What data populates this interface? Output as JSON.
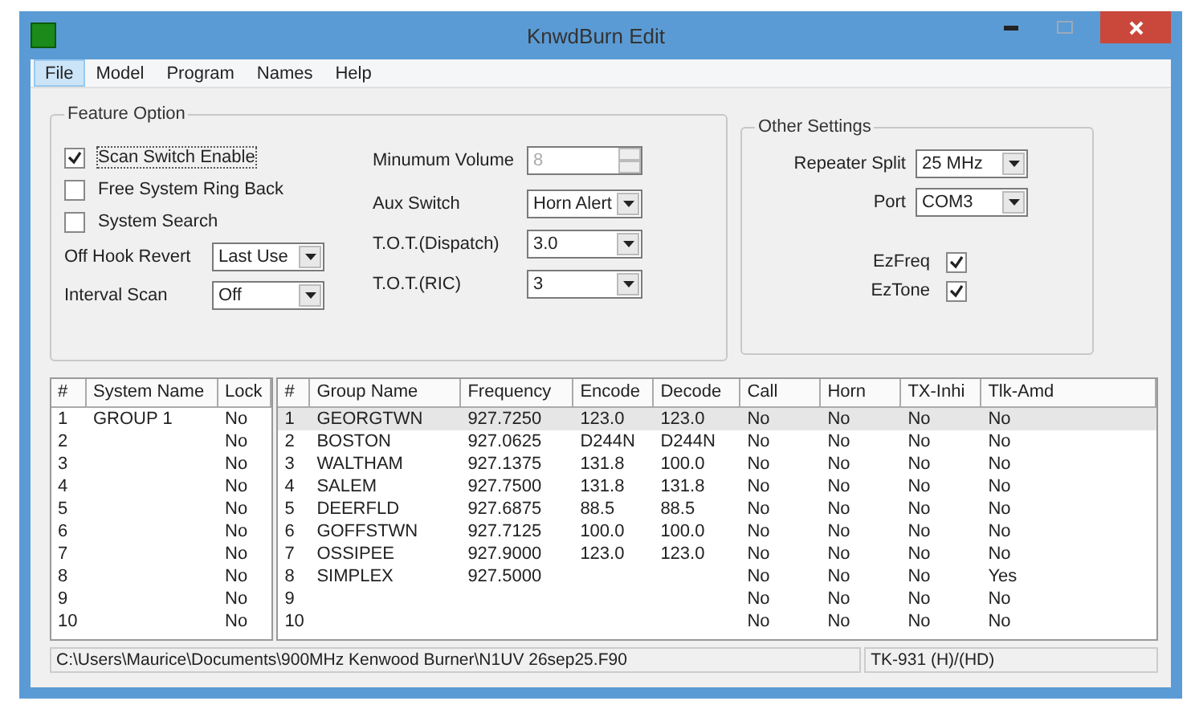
{
  "window": {
    "title": "KnwdBurn Edit"
  },
  "menu": [
    {
      "label": "File",
      "selected": true
    },
    {
      "label": "Model",
      "selected": false
    },
    {
      "label": "Program",
      "selected": false
    },
    {
      "label": "Names",
      "selected": false
    },
    {
      "label": "Help",
      "selected": false
    }
  ],
  "feature_option": {
    "title": "Feature Option",
    "checkboxes": [
      {
        "label": "Scan Switch Enable",
        "checked": true,
        "focused": true
      },
      {
        "label": "Free System Ring Back",
        "checked": false,
        "focused": false
      },
      {
        "label": "System Search",
        "checked": false,
        "focused": false
      }
    ],
    "left_fields": [
      {
        "kind": "dropdown",
        "label": "Off Hook Revert",
        "value": "Last Use",
        "disabled": false
      },
      {
        "kind": "dropdown",
        "label": "Interval Scan",
        "value": "Off",
        "disabled": false
      }
    ],
    "right_fields": [
      {
        "kind": "spin",
        "label": "Minumum Volume",
        "value": "8",
        "disabled": true
      },
      {
        "kind": "dropdown",
        "label": "Aux Switch",
        "value": "Horn Alert",
        "disabled": false
      },
      {
        "kind": "dropdown",
        "label": "T.O.T.(Dispatch)",
        "value": "3.0",
        "disabled": false
      },
      {
        "kind": "dropdown",
        "label": "T.O.T.(RIC)",
        "value": "3",
        "disabled": false
      }
    ]
  },
  "other_settings": {
    "title": "Other Settings",
    "fields": [
      {
        "kind": "dropdown",
        "label": "Repeater Split",
        "value": "25 MHz",
        "disabled": false
      },
      {
        "kind": "dropdown",
        "label": "Port",
        "value": "COM3",
        "disabled": false
      }
    ],
    "checkboxes": [
      {
        "label": "EzFreq",
        "checked": true
      },
      {
        "label": "EzTone",
        "checked": true
      }
    ]
  },
  "system_table": {
    "columns": [
      "#",
      "System Name",
      "Lock"
    ],
    "rows": [
      {
        "cells": [
          "1",
          "GROUP 1",
          "No"
        ],
        "selected": false
      },
      {
        "cells": [
          "2",
          "",
          "No"
        ],
        "selected": false
      },
      {
        "cells": [
          "3",
          "",
          "No"
        ],
        "selected": false
      },
      {
        "cells": [
          "4",
          "",
          "No"
        ],
        "selected": false
      },
      {
        "cells": [
          "5",
          "",
          "No"
        ],
        "selected": false
      },
      {
        "cells": [
          "6",
          "",
          "No"
        ],
        "selected": false
      },
      {
        "cells": [
          "7",
          "",
          "No"
        ],
        "selected": false
      },
      {
        "cells": [
          "8",
          "",
          "No"
        ],
        "selected": false
      },
      {
        "cells": [
          "9",
          "",
          "No"
        ],
        "selected": false
      },
      {
        "cells": [
          "10",
          "",
          "No"
        ],
        "selected": false
      }
    ]
  },
  "group_table": {
    "columns": [
      "#",
      "Group Name",
      "Frequency",
      "Encode",
      "Decode",
      "Call",
      "Horn",
      "TX-Inhi",
      "Tlk-Amd"
    ],
    "rows": [
      {
        "cells": [
          "1",
          "GEORGTWN",
          "927.7250",
          "123.0",
          "123.0",
          "No",
          "No",
          "No",
          "No"
        ],
        "selected": true
      },
      {
        "cells": [
          "2",
          "BOSTON",
          "927.0625",
          "D244N",
          "D244N",
          "No",
          "No",
          "No",
          "No"
        ],
        "selected": false
      },
      {
        "cells": [
          "3",
          "WALTHAM",
          "927.1375",
          "131.8",
          "100.0",
          "No",
          "No",
          "No",
          "No"
        ],
        "selected": false
      },
      {
        "cells": [
          "4",
          "SALEM",
          "927.7500",
          "131.8",
          "131.8",
          "No",
          "No",
          "No",
          "No"
        ],
        "selected": false
      },
      {
        "cells": [
          "5",
          "DEERFLD",
          "927.6875",
          "88.5",
          "88.5",
          "No",
          "No",
          "No",
          "No"
        ],
        "selected": false
      },
      {
        "cells": [
          "6",
          "GOFFSTWN",
          "927.7125",
          "100.0",
          "100.0",
          "No",
          "No",
          "No",
          "No"
        ],
        "selected": false
      },
      {
        "cells": [
          "7",
          "OSSIPEE",
          "927.9000",
          "123.0",
          "123.0",
          "No",
          "No",
          "No",
          "No"
        ],
        "selected": false
      },
      {
        "cells": [
          "8",
          "SIMPLEX",
          "927.5000",
          "",
          "",
          "No",
          "No",
          "No",
          "Yes"
        ],
        "selected": false
      },
      {
        "cells": [
          "9",
          "",
          "",
          "",
          "",
          "No",
          "No",
          "No",
          "No"
        ],
        "selected": false
      },
      {
        "cells": [
          "10",
          "",
          "",
          "",
          "",
          "No",
          "No",
          "No",
          "No"
        ],
        "selected": false
      }
    ]
  },
  "status_bar": {
    "path": "C:\\Users\\Maurice\\Documents\\900MHz Kenwood Burner\\N1UV 26sep25.F90",
    "model": "TK-931 (H)/(HD)"
  }
}
